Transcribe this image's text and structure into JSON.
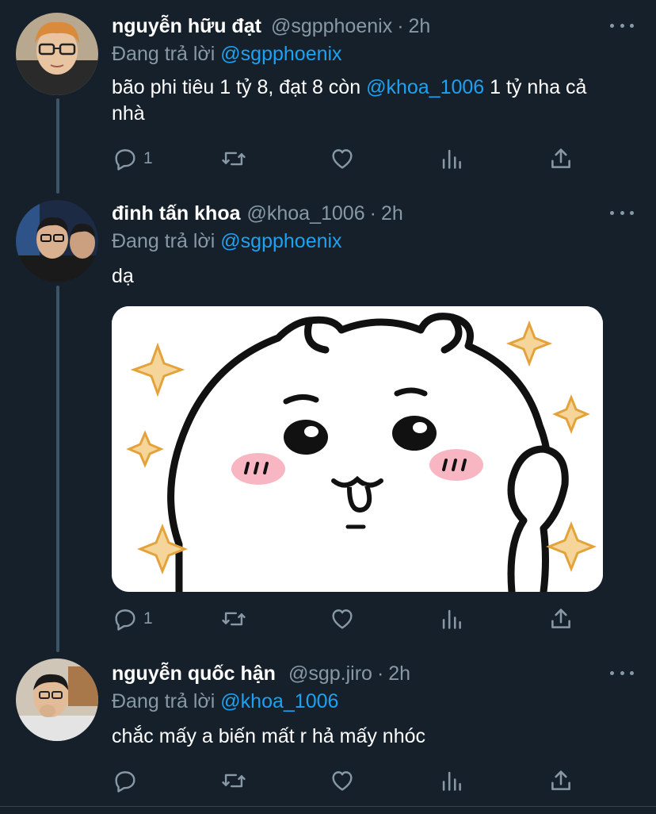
{
  "tweets": [
    {
      "name": "nguyễn hữu đạt",
      "handle": "@sgpphoenix",
      "time": "2h",
      "reply_prefix": "Đang trả lời",
      "reply_to": "@sgpphoenix",
      "text_before": "bão phi tiêu 1 tỷ 8, đạt 8 còn",
      "text_mention": "@khoa_1006",
      "text_after": "1 tỷ nha cả nhà",
      "reply_count": "1",
      "retweet_count": "",
      "like_count": ""
    },
    {
      "name": "đinh tấn khoa",
      "handle": "@khoa_1006",
      "time": "2h",
      "reply_prefix": "Đang trả lời",
      "reply_to": "@sgpphoenix",
      "text": "dạ",
      "media": "sticker-image",
      "reply_count": "1",
      "retweet_count": "",
      "like_count": ""
    },
    {
      "name": "nguyễn quốc hận",
      "handle": "@sgp.jiro",
      "time": "2h",
      "reply_prefix": "Đang trả lời",
      "reply_to": "@khoa_1006",
      "text": "chắc mấy a biến mất r hả mấy nhóc",
      "reply_count": "",
      "retweet_count": "",
      "like_count": ""
    }
  ],
  "separator": "·",
  "icons": {
    "reply": "reply-icon",
    "retweet": "retweet-icon",
    "like": "like-icon",
    "analytics": "analytics-icon",
    "share": "share-icon",
    "more": "more-icon"
  },
  "colors": {
    "background": "#15202b",
    "secondary_text": "#8899a6",
    "mention": "#1da1f2",
    "thread_line": "#3d5466"
  }
}
